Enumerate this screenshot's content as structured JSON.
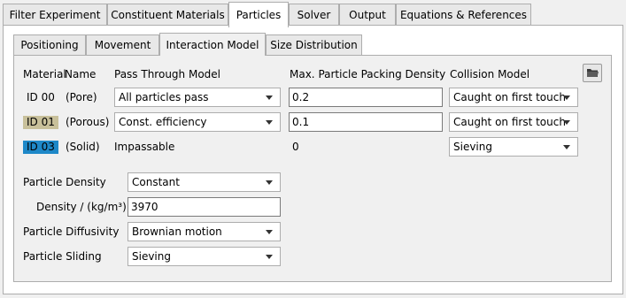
{
  "main_tabs": [
    {
      "label": "Filter Experiment"
    },
    {
      "label": "Constituent Materials"
    },
    {
      "label": "Particles"
    },
    {
      "label": "Solver"
    },
    {
      "label": "Output"
    },
    {
      "label": "Equations & References"
    }
  ],
  "sub_tabs": [
    {
      "label": "Positioning"
    },
    {
      "label": "Movement"
    },
    {
      "label": "Interaction Model"
    },
    {
      "label": "Size Distribution"
    }
  ],
  "table": {
    "headers": {
      "material": "Material",
      "name": "Name",
      "pass_through": "Pass Through Model",
      "packing": "Max. Particle Packing Density",
      "collision": "Collision Model"
    },
    "rows": [
      {
        "id": "ID 00",
        "name": "(Pore)",
        "pass_through": "All particles pass",
        "packing": "0.2",
        "collision": "Caught on first touch"
      },
      {
        "id": "ID 01",
        "name": "(Porous)",
        "pass_through": "Const. efficiency",
        "packing": "0.1",
        "collision": "Caught on first touch"
      },
      {
        "id": "ID 03",
        "name": "(Solid)",
        "pass_through": "Impassable",
        "packing": "0",
        "collision": "Sieving"
      }
    ]
  },
  "colors": {
    "id01_chip": "#c8c09a",
    "id03_chip": "#1e88c8",
    "folder_icon": "#3a3a3a"
  },
  "properties": {
    "density_label": "Particle Density",
    "density_value": "Constant",
    "density_unit_label": "Density / (kg/m³)",
    "density_input": "3970",
    "diffusivity_label": "Particle Diffusivity",
    "diffusivity_value": "Brownian motion",
    "sliding_label": "Particle Sliding",
    "sliding_value": "Sieving"
  },
  "icons": {
    "open_folder": "folder-icon"
  }
}
